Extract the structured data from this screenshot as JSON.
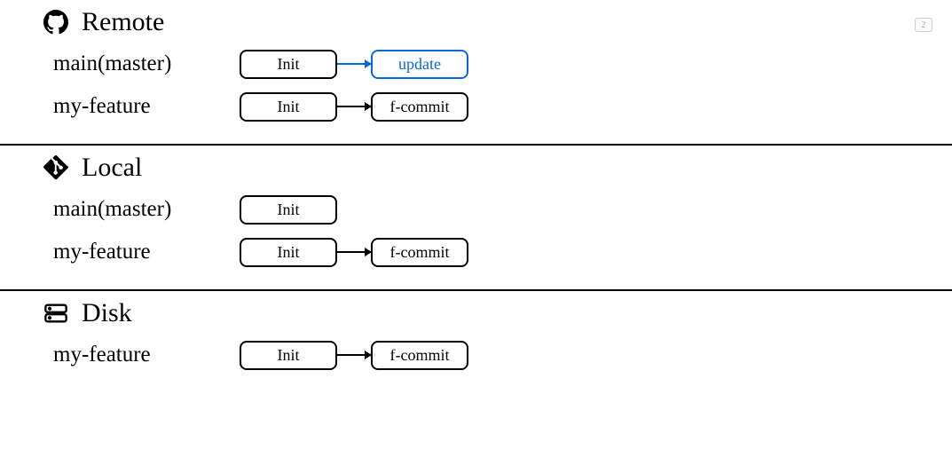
{
  "badge": "2",
  "sections": {
    "remote": {
      "title": "Remote",
      "branches": [
        {
          "name": "main(master)",
          "commits": [
            {
              "label": "Init",
              "highlight": false
            },
            {
              "label": "update",
              "highlight": true
            }
          ],
          "arrowHighlight": true
        },
        {
          "name": "my-feature",
          "commits": [
            {
              "label": "Init",
              "highlight": false
            },
            {
              "label": "f-commit",
              "highlight": false
            }
          ],
          "arrowHighlight": false
        }
      ]
    },
    "local": {
      "title": "Local",
      "branches": [
        {
          "name": "main(master)",
          "commits": [
            {
              "label": "Init",
              "highlight": false
            }
          ]
        },
        {
          "name": "my-feature",
          "commits": [
            {
              "label": "Init",
              "highlight": false
            },
            {
              "label": "f-commit",
              "highlight": false
            }
          ],
          "arrowHighlight": false
        }
      ]
    },
    "disk": {
      "title": "Disk",
      "branches": [
        {
          "name": "my-feature",
          "commits": [
            {
              "label": "Init",
              "highlight": false
            },
            {
              "label": "f-commit",
              "highlight": false
            }
          ],
          "arrowHighlight": false
        }
      ]
    }
  }
}
